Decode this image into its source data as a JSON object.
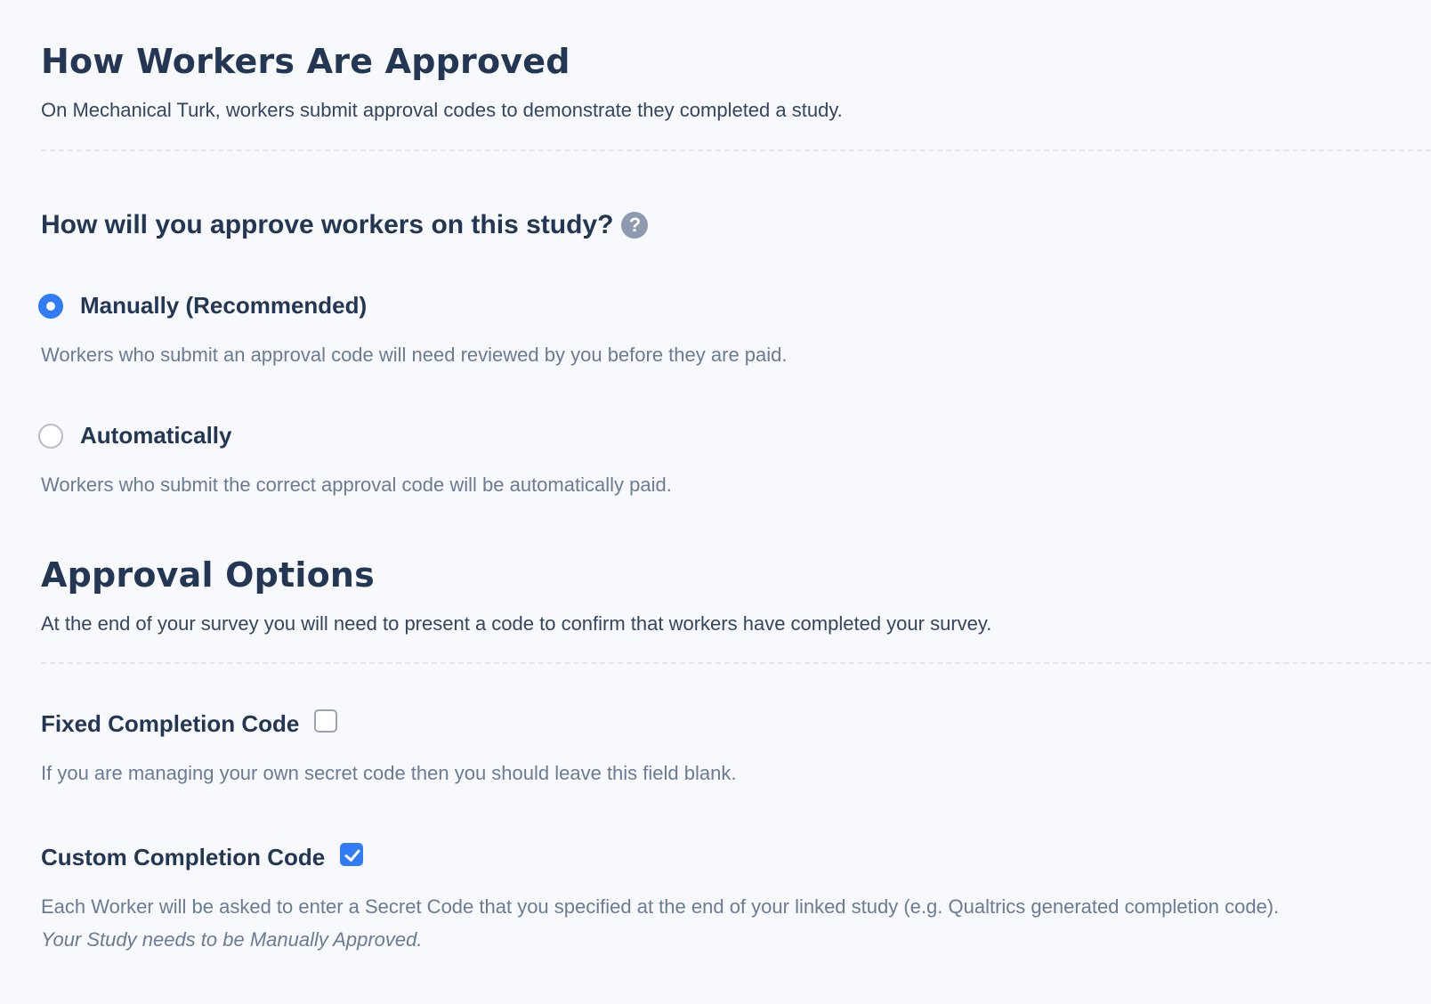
{
  "approval_section": {
    "title": "How Workers Are Approved",
    "description": "On Mechanical Turk, workers submit approval codes to demonstrate they completed a study."
  },
  "approval_method": {
    "question": "How will you approve workers on this study?",
    "help_icon": "question-circle-icon",
    "help_icon_glyph": "?",
    "options": [
      {
        "label": "Manually (Recommended)",
        "description": "Workers who submit an approval code will need reviewed by you before they are paid.",
        "selected": true
      },
      {
        "label": "Automatically",
        "description": "Workers who submit the correct approval code will be automatically paid.",
        "selected": false
      }
    ]
  },
  "approval_options": {
    "title": "Approval Options",
    "description": "At the end of your survey you will need to present a code to confirm that workers have completed your survey.",
    "fixed_code": {
      "label": "Fixed Completion Code",
      "checked": false,
      "description": "If you are managing your own secret code then you should leave this field blank."
    },
    "custom_code": {
      "label": "Custom Completion Code",
      "checked": true,
      "description": "Each Worker will be asked to enter a Secret Code that you specified at the end of your linked study (e.g. Qualtrics generated completion code).",
      "note": "Your Study needs to be Manually Approved."
    }
  },
  "colors": {
    "heading": "#233654",
    "body_text": "#34465f",
    "muted_text": "#6a7b94",
    "accent": "#2f7cf6",
    "help_icon_bg": "#8e9aaf",
    "background": "#f8f9fc"
  }
}
